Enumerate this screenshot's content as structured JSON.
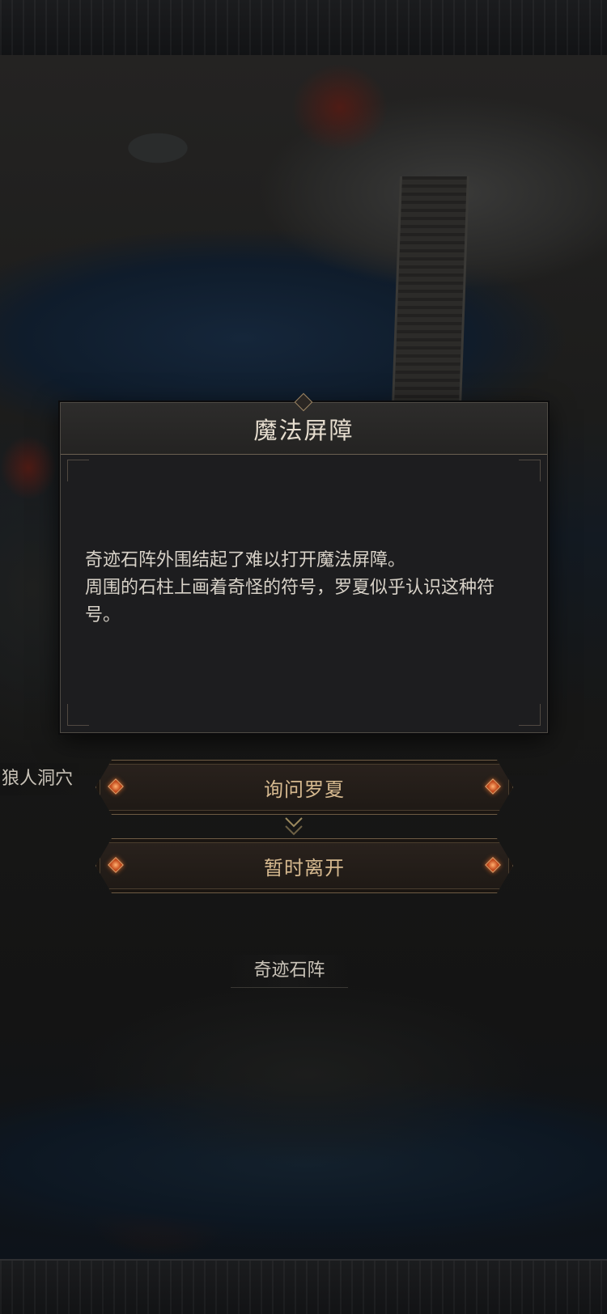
{
  "dialog": {
    "title": "魔法屏障",
    "body_line1": "奇迹石阵外围结起了难以打开魔法屏障。",
    "body_line2": "周围的石柱上画着奇怪的符号，罗夏似乎认识这种符号。"
  },
  "choices": {
    "ask": "询问罗夏",
    "leave": "暂时离开"
  },
  "map_labels": {
    "wolf_cave": "狼人洞穴",
    "stone_circle": "奇迹石阵"
  },
  "colors": {
    "button_text": "#d6b98f",
    "gem": "#c24a1c",
    "dialog_bg": "#1d1d1f"
  }
}
